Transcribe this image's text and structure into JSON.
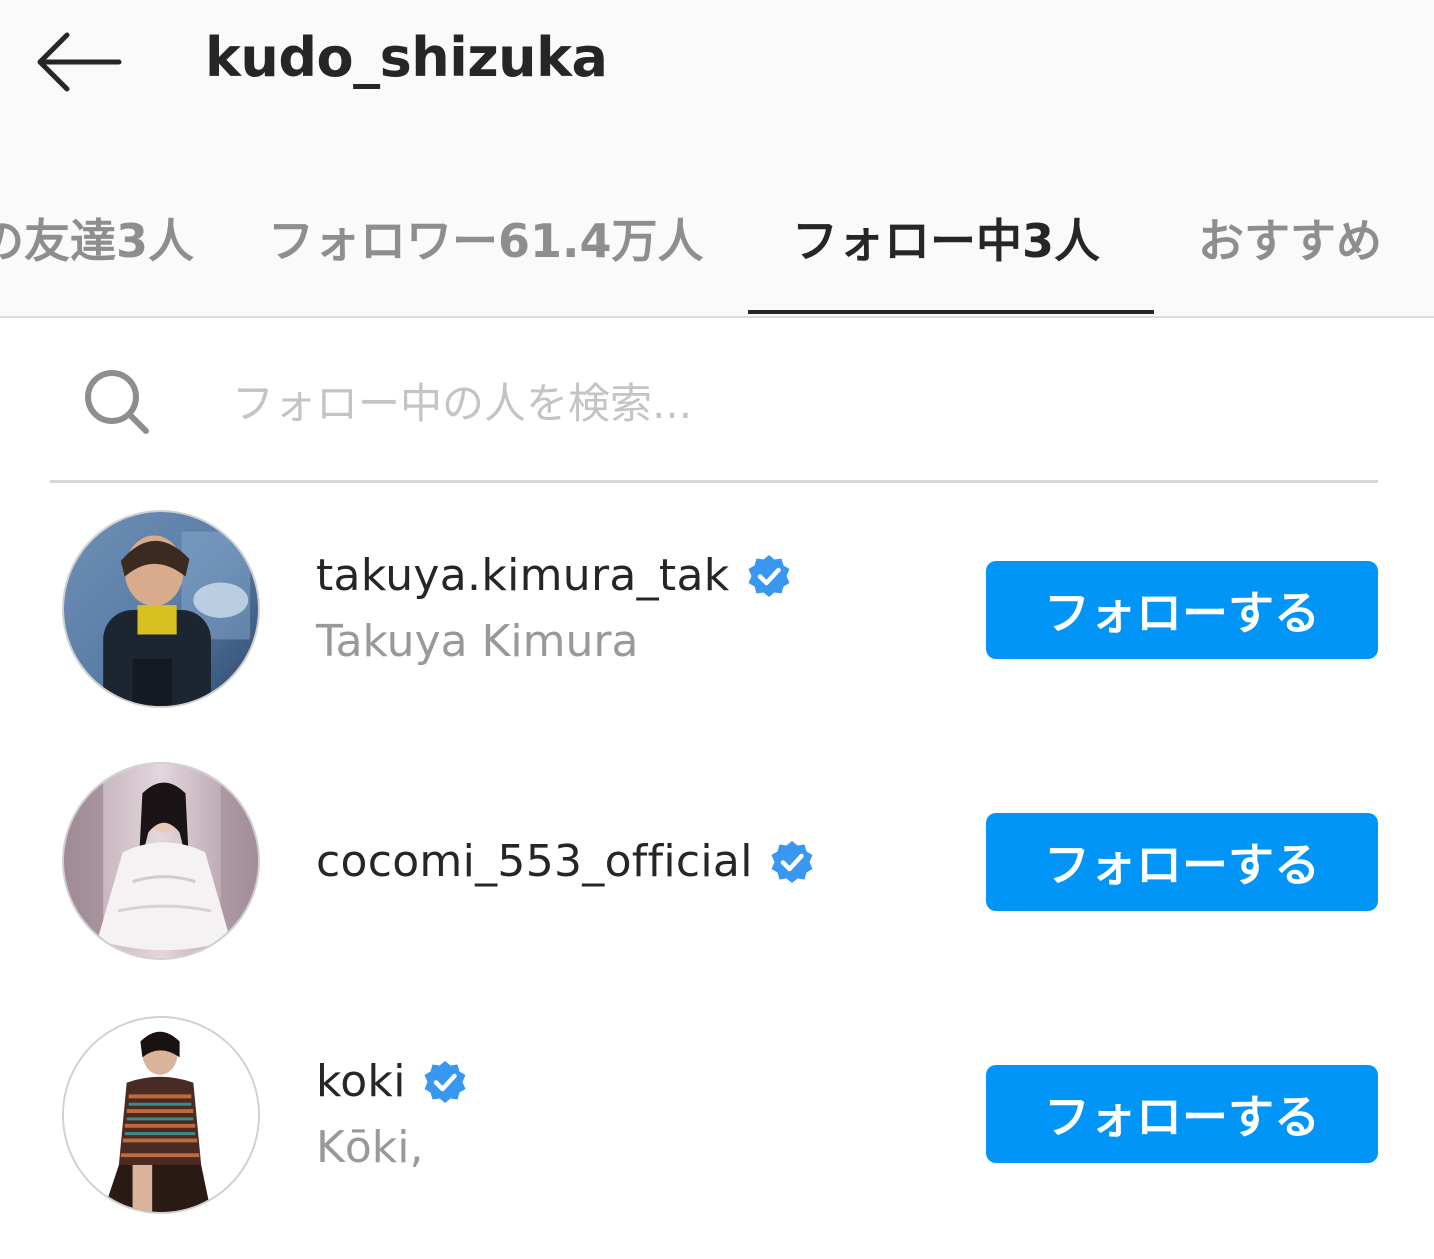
{
  "header": {
    "title": "kudo_shizuka",
    "back_icon": "back-arrow-icon"
  },
  "tabs": [
    {
      "label": "の友達3人",
      "active": false
    },
    {
      "label": "フォロワー61.4万人",
      "active": false
    },
    {
      "label": "フォロー中3人",
      "active": true
    },
    {
      "label": "おすすめ",
      "active": false
    }
  ],
  "search": {
    "placeholder": "フォロー中の人を検索...",
    "value": "",
    "icon": "search-icon"
  },
  "following": [
    {
      "username": "takuya.kimura_tak",
      "full_name": "Takuya Kimura",
      "verified": true,
      "button_label": "フォローする"
    },
    {
      "username": "cocomi_553_official",
      "full_name": "",
      "verified": true,
      "button_label": "フォローする"
    },
    {
      "username": "koki",
      "full_name": "Kōki,",
      "verified": true,
      "button_label": "フォローする"
    }
  ],
  "colors": {
    "accent": "#0095f6",
    "text_primary": "#262626",
    "text_secondary": "#999999",
    "header_bg": "#fafafa"
  }
}
